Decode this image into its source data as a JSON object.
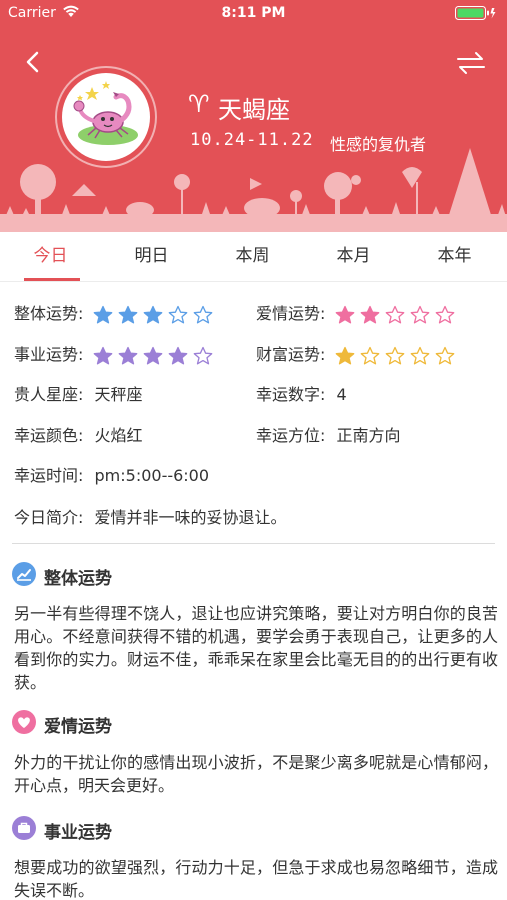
{
  "status_bar": {
    "carrier": "Carrier",
    "time": "8:11 PM"
  },
  "header": {
    "sign_symbol": "♈",
    "sign_name": "天蝎座",
    "date_range": "10.24-11.22",
    "slogan": "性感的复仇者",
    "background_color": "#e35156",
    "icons": {
      "back": "back-chevron-icon",
      "switch": "switch-arrows-icon"
    }
  },
  "tabs": {
    "active_color": "#e35156",
    "items": [
      "今日",
      "明日",
      "本周",
      "本月",
      "本年"
    ]
  },
  "fortune": {
    "overall": {
      "label": "整体运势:",
      "stars": 3,
      "max": 5,
      "color": "#5b9ee6"
    },
    "love": {
      "label": "爱情运势:",
      "stars": 2,
      "max": 5,
      "color": "#ef6fa0"
    },
    "career": {
      "label": "事业运势:",
      "stars": 4,
      "max": 5,
      "color": "#9b7fd6"
    },
    "wealth": {
      "label": "财富运势:",
      "stars": 1,
      "max": 5,
      "color": "#efb93a"
    },
    "noble": {
      "label": "贵人星座:",
      "value": "天秤座"
    },
    "lucky_number": {
      "label": "幸运数字:",
      "value": "4"
    },
    "lucky_color": {
      "label": "幸运颜色:",
      "value": "火焰红"
    },
    "lucky_direction": {
      "label": "幸运方位:",
      "value": "正南方向"
    },
    "lucky_time": {
      "label": "幸运时间:",
      "value": "pm:5:00--6:00"
    },
    "summary": {
      "label": "今日简介:",
      "value": "爱情并非一味的妥协退让。"
    }
  },
  "sections": [
    {
      "title": "整体运势",
      "icon": "chart-icon",
      "icon_color": "#5b9ee6",
      "body": "另一半有些得理不饶人，退让也应讲究策略，要让对方明白你的良苦用心。不经意间获得不错的机遇，要学会勇于表现自己，让更多的人看到你的实力。财运不佳，乖乖呆在家里会比毫无目的的出行更有收获。"
    },
    {
      "title": "爱情运势",
      "icon": "heart-icon",
      "icon_color": "#ef6fa0",
      "body": "外力的干扰让你的感情出现小波折，不是聚少离多呢就是心情郁闷，开心点，明天会更好。"
    },
    {
      "title": "事业运势",
      "icon": "briefcase-icon",
      "icon_color": "#9b7fd6",
      "body": "想要成功的欲望强烈，行动力十足，但急于求成也易忽略细节，造成失误不断。"
    }
  ]
}
